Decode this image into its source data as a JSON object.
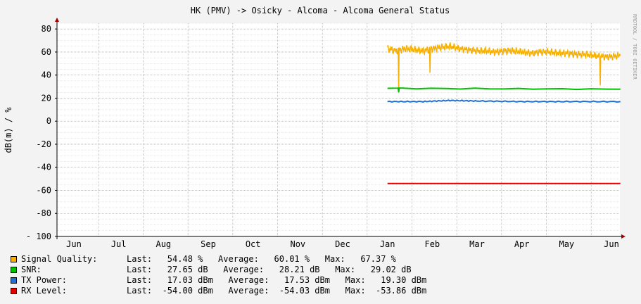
{
  "chart_data": {
    "type": "line",
    "title": "HK (PMV) -> Osicky - Alcoma - Alcoma General Status",
    "ylabel": "dB(m) / %",
    "watermark": "RRDTOOL / TOBI OETIKER",
    "ylim": [
      -100,
      85
    ],
    "yticks": [
      "80",
      "60",
      "40",
      "20",
      "0",
      "-20",
      "-40",
      "-60",
      "-80",
      "- 100"
    ],
    "yticks_values": [
      80,
      60,
      40,
      20,
      0,
      -20,
      -40,
      -60,
      -80,
      -100
    ],
    "x_categories": [
      "Jun",
      "Jul",
      "Aug",
      "Sep",
      "Oct",
      "Nov",
      "Dec",
      "Jan",
      "Feb",
      "Mar",
      "Apr",
      "May",
      "Jun"
    ],
    "grid": true,
    "series": [
      {
        "name": "Signal Quality:",
        "color": "#f8b000",
        "x": [
          7.0,
          7.2,
          7.4,
          7.6,
          7.8,
          8.0,
          8.2,
          8.4,
          8.6,
          8.8,
          9.0,
          9.2,
          9.4,
          9.6,
          9.8,
          10.0,
          10.2,
          10.4,
          10.6,
          10.8,
          11.0,
          11.2,
          11.4,
          11.6,
          11.8,
          12.0,
          12.2
        ],
        "values": [
          63,
          61,
          63,
          62,
          61,
          63,
          64,
          65,
          63,
          62,
          61,
          61,
          60,
          61,
          61,
          60,
          59,
          60,
          60,
          59,
          59,
          58,
          58,
          57,
          56,
          56,
          57
        ],
        "spikes": [
          {
            "x": 7.25,
            "y": 25
          },
          {
            "x": 7.95,
            "y": 42
          },
          {
            "x": 11.75,
            "y": 31
          }
        ]
      },
      {
        "name": "SNR:",
        "color": "#00c000",
        "x": [
          7.0,
          12.2
        ],
        "values": [
          28.5,
          27.8
        ],
        "spikes": [
          {
            "x": 7.25,
            "y": 25
          }
        ]
      },
      {
        "name": "TX Power:",
        "color": "#2070d0",
        "x": [
          7.0,
          7.8,
          8.4,
          9.0,
          10.0,
          11.0,
          12.2
        ],
        "values": [
          17,
          17,
          18,
          17.5,
          17,
          17,
          17
        ]
      },
      {
        "name": "RX Level:",
        "color": "#e00000",
        "x": [
          7.0,
          12.2
        ],
        "values": [
          -54,
          -54
        ]
      }
    ]
  },
  "legend": [
    {
      "name": "Signal Quality:",
      "color": "#f8b000",
      "stats": "Last:   54.48 %   Average:   60.01 %   Max:   67.37 %"
    },
    {
      "name": "SNR:",
      "color": "#00c000",
      "stats": "Last:   27.65 dB   Average:   28.21 dB   Max:   29.02 dB"
    },
    {
      "name": "TX Power:",
      "color": "#2070d0",
      "stats": "Last:   17.03 dBm   Average:   17.53 dBm   Max:   19.30 dBm"
    },
    {
      "name": "RX Level:",
      "color": "#e00000",
      "stats": "Last:  -54.00 dBm   Average:  -54.03 dBm   Max:  -53.86 dBm"
    }
  ]
}
